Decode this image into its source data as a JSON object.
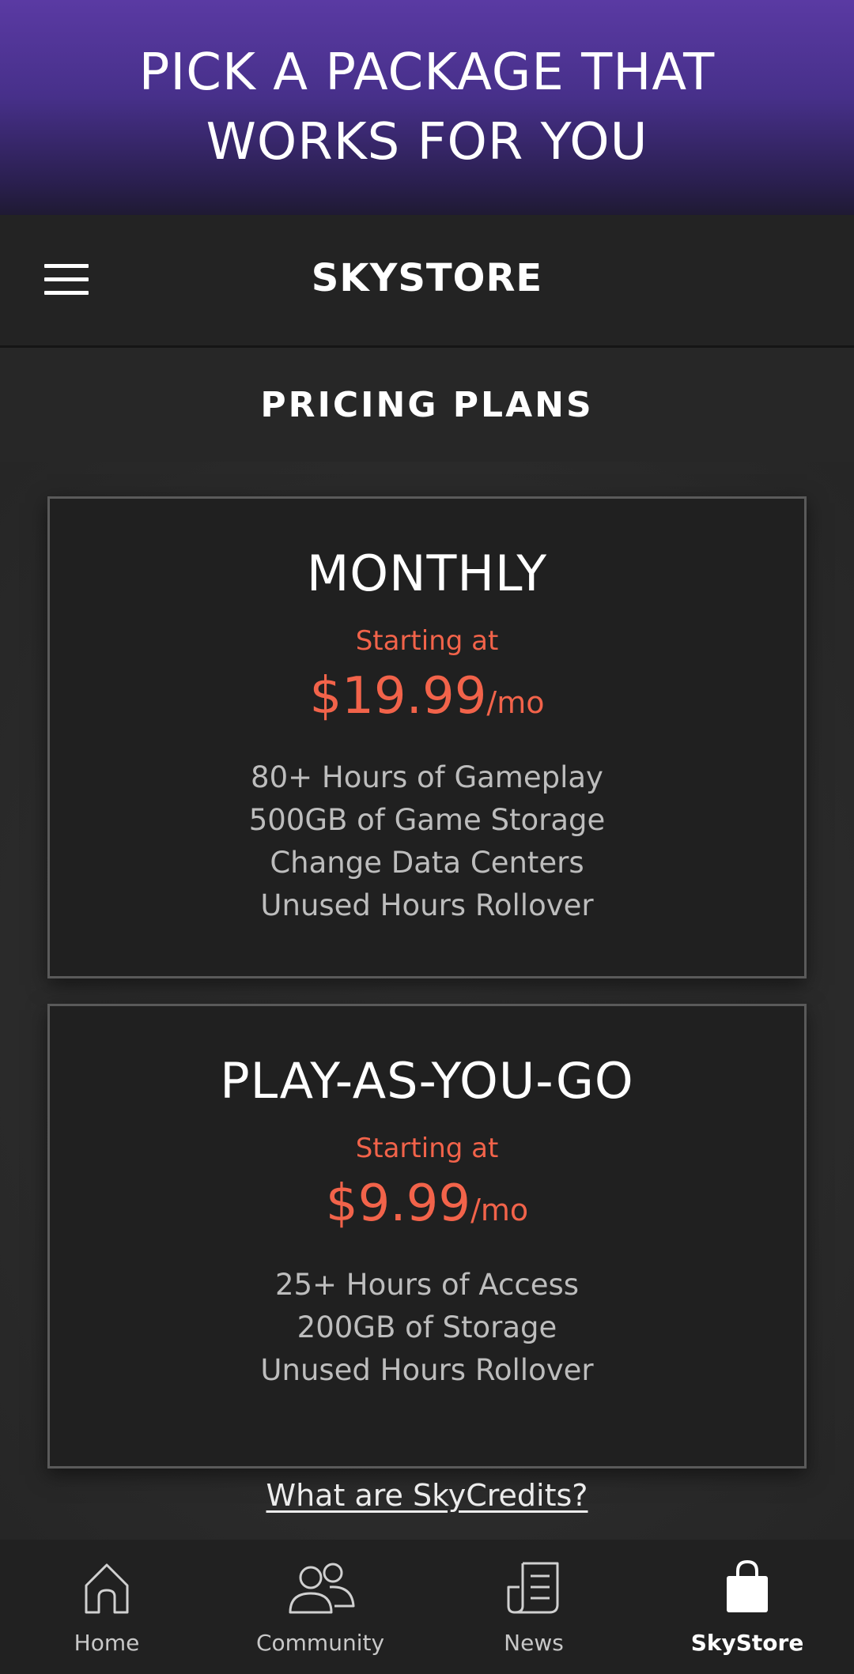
{
  "hero": {
    "title": "PICK A PACKAGE THAT WORKS FOR YOU"
  },
  "topbar": {
    "title": "SKYSTORE",
    "menu_icon": "hamburger-menu-icon"
  },
  "subbar": {
    "title": "PRICING PLANS"
  },
  "plans": [
    {
      "name": "MONTHLY",
      "starting_label": "Starting at",
      "price": "$19.99",
      "period": "/mo",
      "features": [
        "80+ Hours of Gameplay",
        "500GB of Game Storage",
        "Change Data Centers",
        "Unused Hours Rollover"
      ]
    },
    {
      "name": "PLAY-AS-YOU-GO",
      "starting_label": "Starting at",
      "price": "$9.99",
      "period": "/mo",
      "features": [
        "25+ Hours of Access",
        "200GB of Storage",
        "Unused Hours Rollover"
      ]
    }
  ],
  "credits_link": "What are SkyCredits?",
  "bottom_nav": [
    {
      "label": "Home",
      "icon": "home-icon",
      "active": false
    },
    {
      "label": "Community",
      "icon": "community-icon",
      "active": false
    },
    {
      "label": "News",
      "icon": "news-icon",
      "active": false
    },
    {
      "label": "SkyStore",
      "icon": "shopping-bag-icon",
      "active": true
    }
  ],
  "colors": {
    "accent": "#f2634a",
    "hero_purple": "#5a3aa3",
    "background": "#2a2a2a",
    "card": "#202020"
  }
}
